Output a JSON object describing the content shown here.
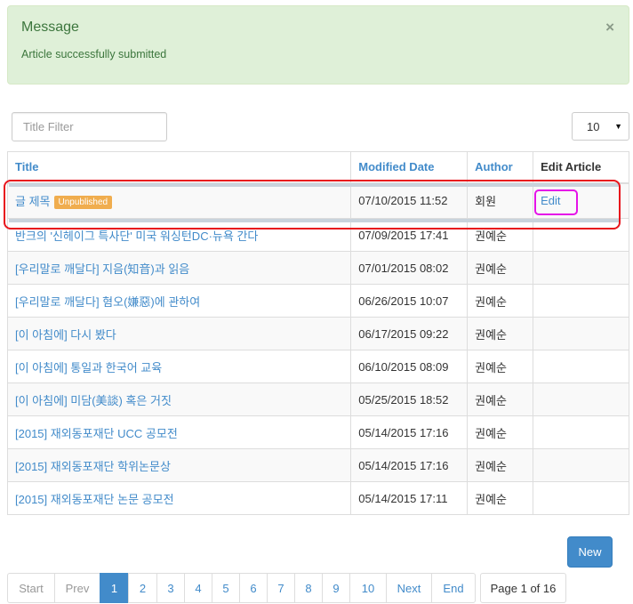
{
  "alert": {
    "title": "Message",
    "message": "Article successfully submitted",
    "close_glyph": "×",
    "bg_color": "#dff0d8",
    "text_color": "#3c763d"
  },
  "filter": {
    "placeholder": "Title Filter",
    "value": ""
  },
  "page_size": {
    "selected": "10",
    "arrow": "▼"
  },
  "table": {
    "headers": {
      "title": "Title",
      "modified": "Modified Date",
      "author": "Author",
      "edit": "Edit Article"
    },
    "rows": [
      {
        "title": "글 제목",
        "status": "Unpublished",
        "modified": "07/10/2015 11:52",
        "author": "회원",
        "edit": "Edit"
      },
      {
        "title": "반크의 '신헤이그 특사단' 미국 워싱턴DC·뉴욕 간다",
        "status": "",
        "modified": "07/09/2015 17:41",
        "author": "권예순",
        "edit": ""
      },
      {
        "title": "[우리말로 깨달다] 지음(知音)과 읽음",
        "status": "",
        "modified": "07/01/2015 08:02",
        "author": "권예순",
        "edit": ""
      },
      {
        "title": "[우리말로 깨달다] 혐오(嫌惡)에 관하여",
        "status": "",
        "modified": "06/26/2015 10:07",
        "author": "권예순",
        "edit": ""
      },
      {
        "title": "[이 아침에] 다시 봤다",
        "status": "",
        "modified": "06/17/2015 09:22",
        "author": "권예순",
        "edit": ""
      },
      {
        "title": "[이 아침에] 통일과 한국어 교육",
        "status": "",
        "modified": "06/10/2015 08:09",
        "author": "권예순",
        "edit": ""
      },
      {
        "title": "[이 아침에] 미담(美談) 혹은 거짓",
        "status": "",
        "modified": "05/25/2015 18:52",
        "author": "권예순",
        "edit": ""
      },
      {
        "title": "[2015] 재외동포재단 UCC 공모전",
        "status": "",
        "modified": "05/14/2015 17:16",
        "author": "권예순",
        "edit": ""
      },
      {
        "title": "[2015] 재외동포재단 학위논문상",
        "status": "",
        "modified": "05/14/2015 17:16",
        "author": "권예순",
        "edit": ""
      },
      {
        "title": "[2015] 재외동포재단 논문 공모전",
        "status": "",
        "modified": "05/14/2015 17:11",
        "author": "권예순",
        "edit": ""
      }
    ]
  },
  "new_button": "New",
  "pagination": {
    "start": "Start",
    "prev": "Prev",
    "pages": [
      "1",
      "2",
      "3",
      "4",
      "5",
      "6",
      "7",
      "8",
      "9",
      "10"
    ],
    "active_page": "1",
    "next": "Next",
    "end": "End",
    "info": "Page 1 of 16"
  },
  "colors": {
    "link": "#428bca",
    "badge": "#f0ad4e",
    "highlight_red": "#e8141c",
    "highlight_magenta": "#e513e8"
  }
}
